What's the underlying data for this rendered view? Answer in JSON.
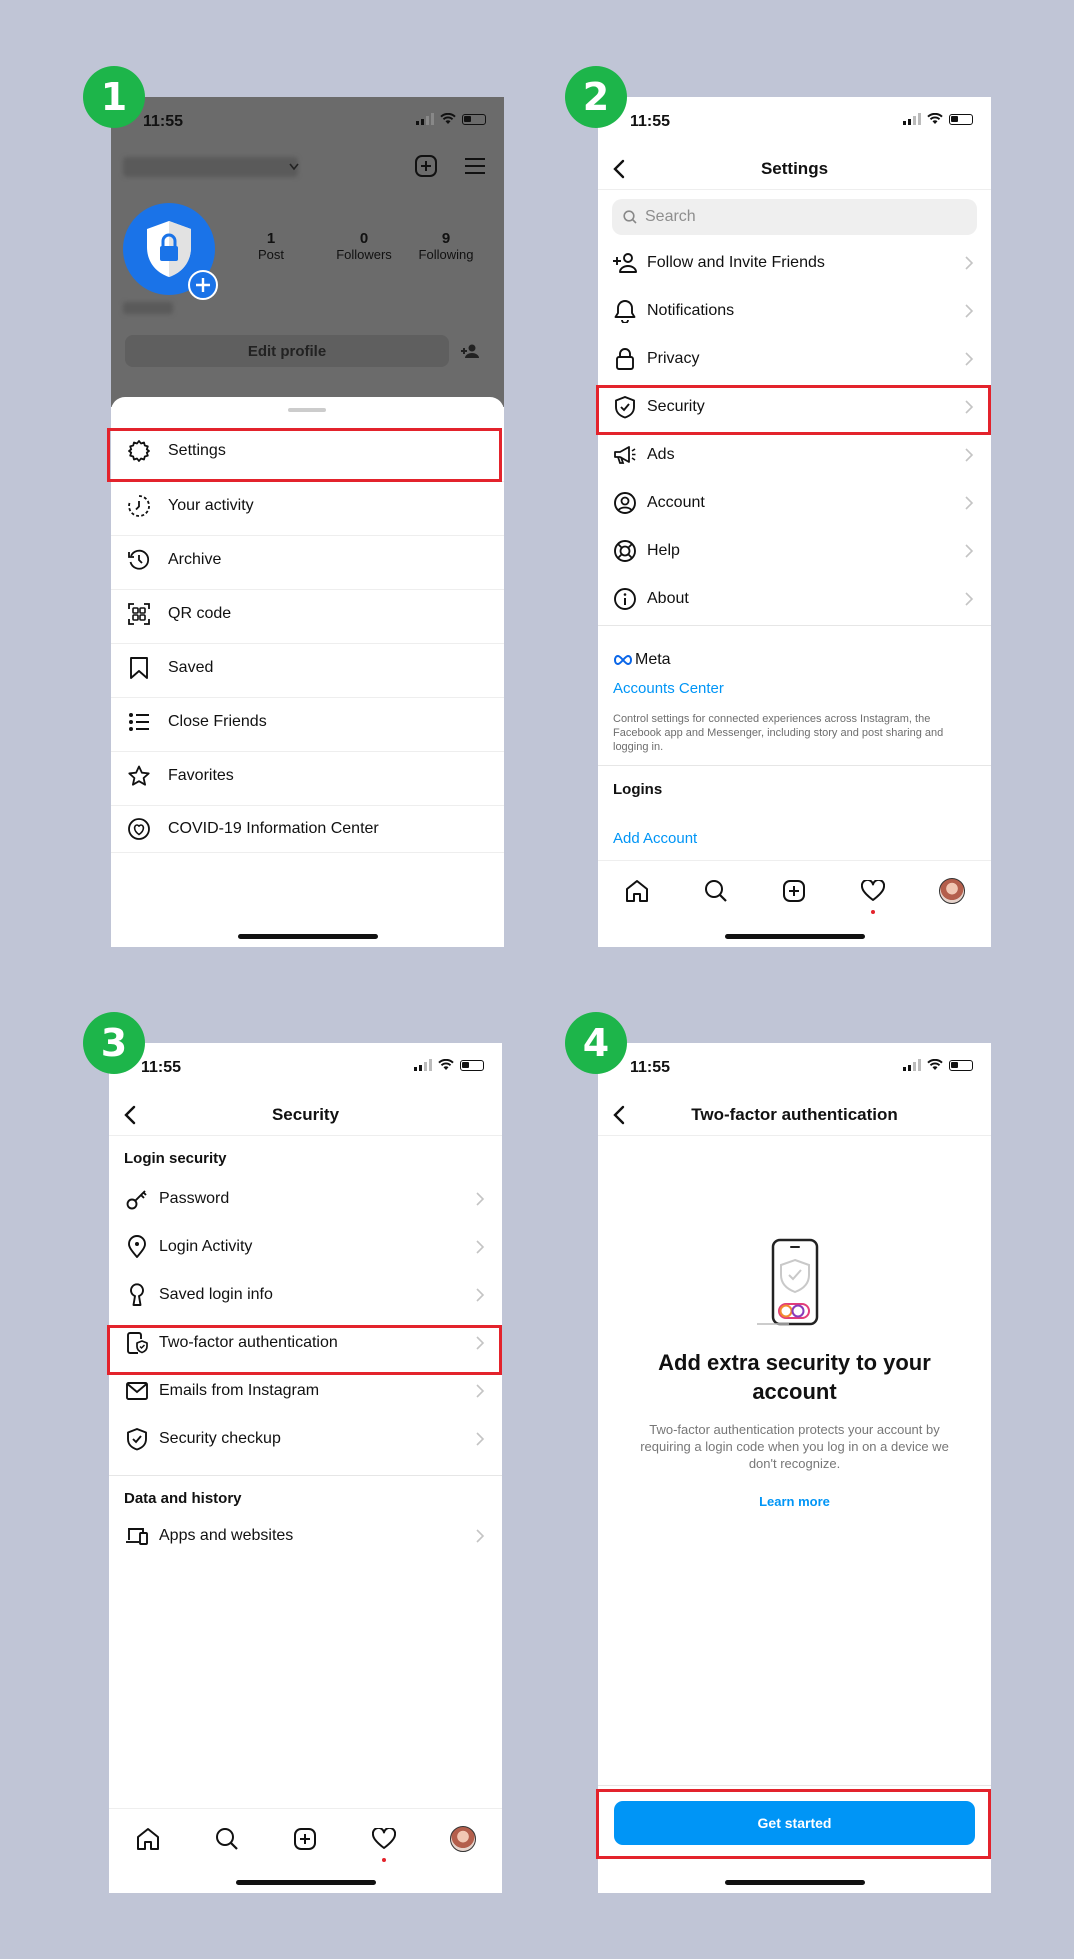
{
  "steps": [
    "1",
    "2",
    "3",
    "4"
  ],
  "status_time": "11:55",
  "screen1": {
    "stats": [
      {
        "num": "1",
        "label": "Post"
      },
      {
        "num": "0",
        "label": "Followers"
      },
      {
        "num": "9",
        "label": "Following"
      }
    ],
    "edit_profile": "Edit profile",
    "menu": [
      {
        "label": "Settings",
        "icon": "settings-icon"
      },
      {
        "label": "Your activity",
        "icon": "activity-icon"
      },
      {
        "label": "Archive",
        "icon": "archive-icon"
      },
      {
        "label": "QR code",
        "icon": "qr-code-icon"
      },
      {
        "label": "Saved",
        "icon": "bookmark-icon"
      },
      {
        "label": "Close Friends",
        "icon": "close-friends-icon"
      },
      {
        "label": "Favorites",
        "icon": "star-icon"
      },
      {
        "label": "COVID-19 Information Center",
        "icon": "covid-info-icon"
      }
    ]
  },
  "screen2": {
    "title": "Settings",
    "search_placeholder": "Search",
    "items": [
      {
        "label": "Follow and Invite Friends",
        "icon": "add-person-icon"
      },
      {
        "label": "Notifications",
        "icon": "bell-icon"
      },
      {
        "label": "Privacy",
        "icon": "lock-icon"
      },
      {
        "label": "Security",
        "icon": "shield-icon"
      },
      {
        "label": "Ads",
        "icon": "megaphone-icon"
      },
      {
        "label": "Account",
        "icon": "account-icon"
      },
      {
        "label": "Help",
        "icon": "lifebuoy-icon"
      },
      {
        "label": "About",
        "icon": "info-icon"
      }
    ],
    "meta_label": "Meta",
    "accounts_center": "Accounts Center",
    "accounts_desc": "Control settings for connected experiences across Instagram, the Facebook app and Messenger, including story and post sharing and logging in.",
    "logins_heading": "Logins",
    "add_account": "Add Account"
  },
  "screen3": {
    "title": "Security",
    "section1": "Login security",
    "items1": [
      {
        "label": "Password",
        "icon": "key-icon"
      },
      {
        "label": "Login Activity",
        "icon": "location-pin-icon"
      },
      {
        "label": "Saved login info",
        "icon": "keyhole-icon"
      },
      {
        "label": "Two-factor authentication",
        "icon": "phone-shield-icon"
      },
      {
        "label": "Emails from Instagram",
        "icon": "mail-icon"
      },
      {
        "label": "Security checkup",
        "icon": "shield-check-icon"
      }
    ],
    "section2": "Data and history",
    "items2": [
      {
        "label": "Apps and websites",
        "icon": "devices-icon"
      }
    ]
  },
  "screen4": {
    "title": "Two-factor authentication",
    "heading": "Add extra security to your account",
    "desc": "Two-factor authentication protects your account by requiring a login code when you log in on a device we don't recognize.",
    "learn_more": "Learn more",
    "cta": "Get started"
  },
  "colors": {
    "accent": "#0095f6",
    "highlight": "#e3232c",
    "badge": "#1db54a",
    "background": "#c0c5d6"
  }
}
